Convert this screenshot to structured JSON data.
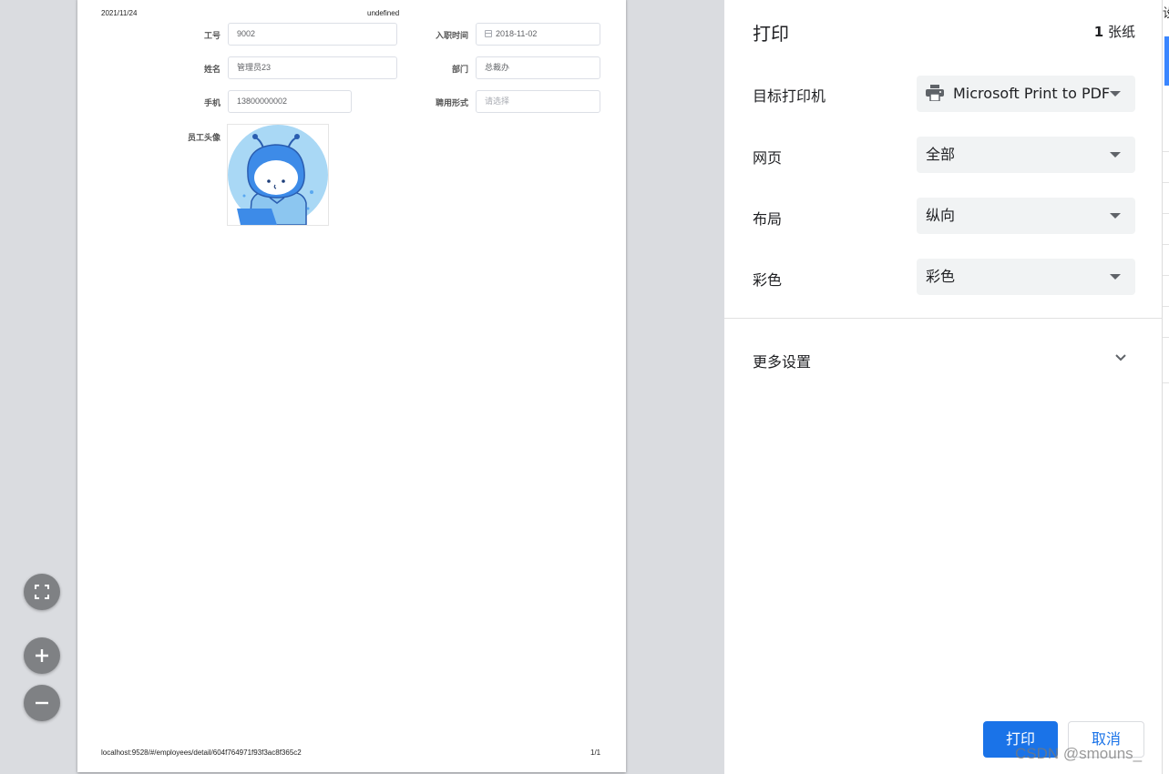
{
  "preview_page": {
    "header_date": "2021/11/24",
    "header_title": "undefined",
    "footer_url": "localhost:9528/#/employees/detail/604f764971f93f3ac8f365c2",
    "footer_page": "1/1",
    "form": {
      "work_no_label": "工号",
      "work_no_value": "9002",
      "hire_date_label": "入职时间",
      "hire_date_value": "2018-11-02",
      "name_label": "姓名",
      "name_value": "管理员23",
      "department_label": "部门",
      "department_value": "总裁办",
      "mobile_label": "手机",
      "mobile_value": "13800000002",
      "employ_form_label": "聘用形式",
      "employ_form_placeholder": "请选择",
      "avatar_label": "员工头像"
    }
  },
  "zoom_controls": {
    "icons": [
      "fit-to-page-icon",
      "zoom-in-icon",
      "zoom-out-icon"
    ]
  },
  "print_panel": {
    "title": "打印",
    "sheet_count": "1",
    "sheet_unit": "张纸",
    "destination_label": "目标打印机",
    "destination_value": "Microsoft Print to PDF",
    "pages_label": "网页",
    "pages_value": "全部",
    "layout_label": "布局",
    "layout_value": "纵向",
    "color_label": "彩色",
    "color_value": "彩色",
    "more_settings": "更多设置",
    "print_button": "打印",
    "cancel_button": "取消"
  },
  "edge_char": "设",
  "watermark": "CSDN @smouns_",
  "colors": {
    "accent": "#1a73e8",
    "preview_bg": "#dadce0",
    "select_bg": "#f1f3f4",
    "avatar_blue": "#3d8be8",
    "avatar_bg": "#a9d8f5"
  }
}
